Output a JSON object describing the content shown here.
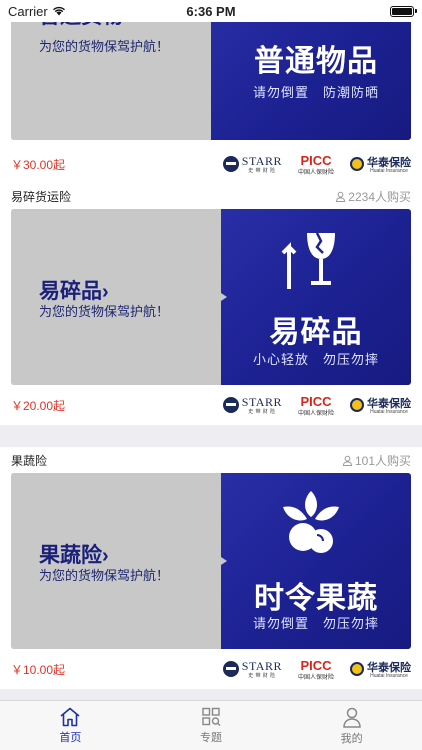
{
  "status": {
    "carrier": "Carrier",
    "time": "6:36 PM"
  },
  "cards": [
    {
      "title": "",
      "count": "",
      "banner_main": "普通货物",
      "banner_sub": "为您的货物保驾护航！",
      "banner_big": "普通物品",
      "banner_tag": "请勿倒置　防潮防晒",
      "price": "￥30.00起"
    },
    {
      "title": "易碎货运险",
      "count": "2234人购买",
      "banner_main": "易碎品",
      "banner_sub": "为您的货物保驾护航！",
      "banner_big": "易碎品",
      "banner_tag": "小心轻放　勿压勿摔",
      "price": "￥20.00起"
    },
    {
      "title": "果蔬险",
      "count": "101人购买",
      "banner_main": "果蔬险",
      "banner_sub": "为您的货物保驾护航！",
      "banner_big": "时令果蔬",
      "banner_tag": "请勿倒置　勿压勿摔",
      "price": "￥10.00起"
    }
  ],
  "logos": {
    "starr": "STARR",
    "starr_sub": "史 带 财 险",
    "picc": "PICC",
    "picc_sub": "中国人保财险",
    "huatai": "华泰保险",
    "huatai_sub": "Huatai Insurance"
  },
  "tabs": [
    {
      "label": "首页",
      "icon": "home-icon",
      "active": true
    },
    {
      "label": "专题",
      "icon": "topics-icon",
      "active": false
    },
    {
      "label": "我的",
      "icon": "profile-icon",
      "active": false
    }
  ],
  "colors": {
    "accent": "#1d2eae",
    "banner_blue": "#1d2294",
    "price_red": "#e0342a"
  }
}
